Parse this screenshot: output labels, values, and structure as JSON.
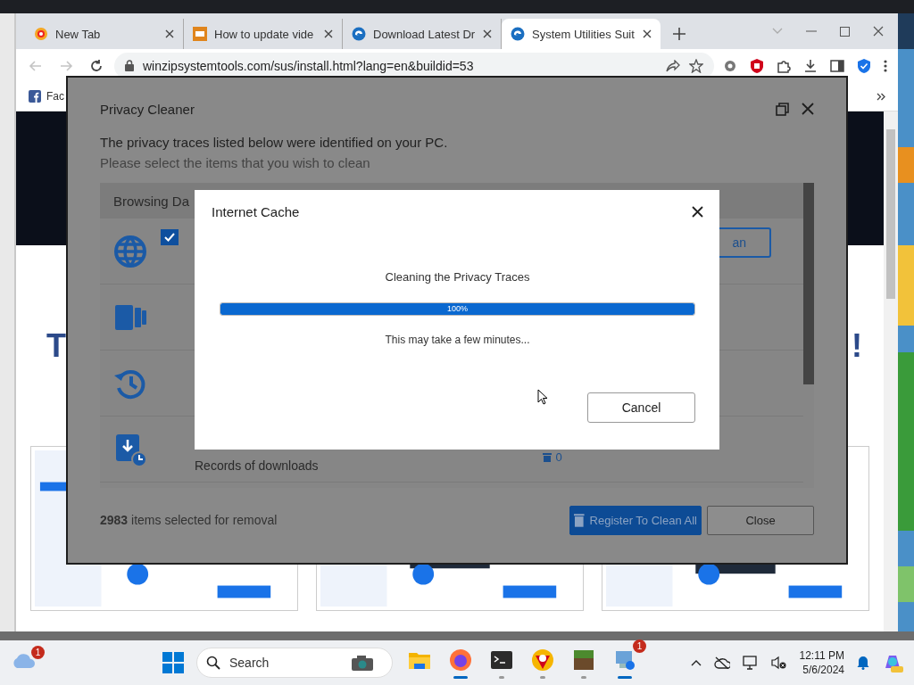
{
  "browser": {
    "tabs": [
      {
        "kind": "ring",
        "title": "New Tab",
        "selected": false
      },
      {
        "kind": "mc",
        "title": "How to update vide",
        "selected": false
      },
      {
        "kind": "swirl",
        "title": "Download Latest Dr",
        "selected": false
      },
      {
        "kind": "swirl",
        "title": "System Utilities Suit",
        "selected": true
      }
    ],
    "nav": [
      {
        "kind": "back",
        "disabled": true
      },
      {
        "kind": "forward",
        "disabled": true
      },
      {
        "kind": "reload",
        "disabled": false
      }
    ],
    "address": "winzipsystemtools.com/sus/install.html?lang=en&buildid=53",
    "bookmarks": [
      {
        "label": "Fac"
      }
    ]
  },
  "web_page": {
    "heading_fragments": [
      "T",
      "!"
    ],
    "thumbnails": [
      {
        "kind": "picture"
      },
      {
        "kind": "picture"
      },
      {
        "kind": "picture"
      }
    ]
  },
  "privacy_cleaner": {
    "title": "Privacy Cleaner",
    "intro": "The privacy traces listed below were identified on your PC.",
    "instruction": "Please select the items that you wish to clean",
    "list_header": "Browsing Da",
    "traces": [
      {
        "kind": "globe",
        "checked": true,
        "action": "an"
      },
      {
        "kind": "cards"
      },
      {
        "kind": "history"
      },
      {
        "kind": "download",
        "label": "Records of downloads",
        "count": "0"
      }
    ],
    "summary": "**2983** items selected for removal",
    "buttons": [
      {
        "kind": "primary",
        "label": "Register To Clean All"
      },
      {
        "kind": "secondary",
        "label": "Close"
      }
    ]
  },
  "progress_dialog": {
    "title": "Internet Cache",
    "heading": "Cleaning the Privacy Traces",
    "level": 1,
    "percent": "100%",
    "note": "This may take a few minutes...",
    "button": "Cancel"
  },
  "taskbar": {
    "weather_badge": "1",
    "search_placeholder": "Search",
    "apps": [
      {
        "kind": "explorer",
        "open": false,
        "active": false
      },
      {
        "kind": "firefox",
        "open": true,
        "active": true
      },
      {
        "kind": "terminal",
        "open": true,
        "active": false
      },
      {
        "kind": "browser",
        "open": true,
        "active": false
      },
      {
        "kind": "minecraft",
        "open": true,
        "active": false
      },
      {
        "kind": "utility",
        "open": true,
        "active": true,
        "badge": "1"
      }
    ],
    "time": "12:11 PM",
    "date": "5/6/2024"
  }
}
